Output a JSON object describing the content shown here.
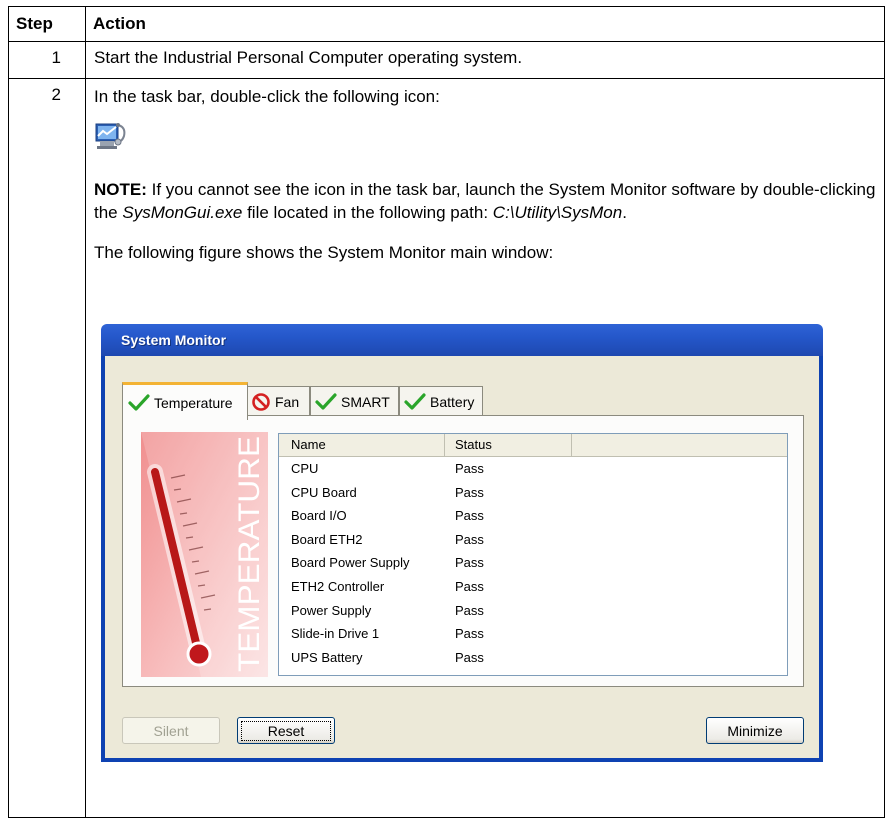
{
  "table": {
    "header": {
      "step": "Step",
      "action": "Action"
    },
    "rows": [
      {
        "step": "1",
        "action": "Start the Industrial Personal Computer operating system."
      },
      {
        "step": "2",
        "intro": "In the task bar, double-click the following icon:",
        "note_label": "NOTE:",
        "note_text_1": " If you cannot see the icon in the task bar, launch the System Monitor software by double-clicking the ",
        "note_file": "SysMonGui.exe",
        "note_text_2": " file located in the following path: ",
        "note_path": "C:\\Utility\\SysMon",
        "note_end": ".",
        "figure_intro": "The following figure shows the System Monitor main window:"
      }
    ]
  },
  "window": {
    "title": "System Monitor",
    "tabs": [
      {
        "label": "Temperature",
        "icon": "check-icon",
        "active": true
      },
      {
        "label": "Fan",
        "icon": "prohibited-icon",
        "active": false
      },
      {
        "label": "SMART",
        "icon": "check-icon",
        "active": false
      },
      {
        "label": "Battery",
        "icon": "check-icon",
        "active": false
      }
    ],
    "thermometer_text": "TEMPERATURE",
    "list": {
      "columns": [
        "Name",
        "Status"
      ],
      "rows": [
        {
          "name": "CPU",
          "status": "Pass"
        },
        {
          "name": "CPU Board",
          "status": "Pass"
        },
        {
          "name": "Board I/O",
          "status": "Pass"
        },
        {
          "name": "Board ETH2",
          "status": "Pass"
        },
        {
          "name": "Board Power Supply",
          "status": "Pass"
        },
        {
          "name": "ETH2 Controller",
          "status": "Pass"
        },
        {
          "name": "Power Supply",
          "status": "Pass"
        },
        {
          "name": "Slide-in Drive 1",
          "status": "Pass"
        },
        {
          "name": "UPS Battery",
          "status": "Pass"
        }
      ]
    },
    "buttons": {
      "silent": "Silent",
      "reset": "Reset",
      "minimize": "Minimize"
    }
  },
  "colors": {
    "title_bar": "#2456c8",
    "check": "#2aa52a",
    "prohibited": "#d42020",
    "tab_highlight": "#f3b334"
  }
}
